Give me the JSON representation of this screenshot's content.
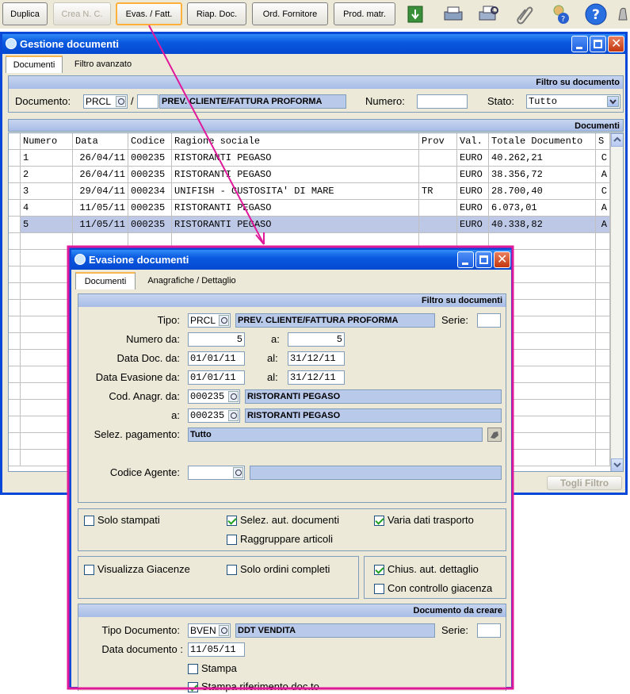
{
  "toolbar": {
    "buttons": [
      "Duplica",
      "Crea N. C.",
      "Evas. / Fatt.",
      "Riap. Doc.",
      "Ord. Fornitore",
      "Prod. matr."
    ],
    "icons": [
      "export-icon",
      "print-icon",
      "print-preview-icon",
      "attach-icon",
      "user-help-icon",
      "help-icon",
      "bell-icon"
    ]
  },
  "main": {
    "title": "Gestione documenti",
    "tabs": [
      "Documenti",
      "Filtro avanzato"
    ],
    "filter_band": "Filtro su documento",
    "documento_label": "Documento:",
    "documento_code": "PRCL",
    "documento_sep": "/",
    "documento_desc": "PREV. CLIENTE/FATTURA PROFORMA",
    "numero_label": "Numero:",
    "numero_value": "",
    "stato_label": "Stato:",
    "stato_value": "Tutto",
    "grid_band": "Documenti",
    "columns": [
      "Numero",
      "Data",
      "Codice",
      "Ragione sociale",
      "Prov",
      "Val.",
      "Totale Documento",
      "S"
    ],
    "rows": [
      [
        "1",
        "26/04/11",
        "000235",
        "RISTORANTI PEGASO",
        "",
        "EURO",
        "40.262,21",
        "C"
      ],
      [
        "2",
        "26/04/11",
        "000235",
        "RISTORANTI PEGASO",
        "",
        "EURO",
        "38.356,72",
        "A"
      ],
      [
        "3",
        "29/04/11",
        "000234",
        "UNIFISH - GUSTOSITA' DI MARE",
        "TR",
        "EURO",
        "28.700,40",
        "C"
      ],
      [
        "4",
        "11/05/11",
        "000235",
        "RISTORANTI PEGASO",
        "",
        "EURO",
        "6.073,01",
        "A"
      ],
      [
        "5",
        "11/05/11",
        "000235",
        "RISTORANTI PEGASO",
        "",
        "EURO",
        "40.338,82",
        "A"
      ]
    ],
    "selected_row": 5,
    "toggle_filter": "Togli Filtro"
  },
  "dialog": {
    "title": "Evasione documenti",
    "tabs": [
      "Documenti",
      "Anagrafiche / Dettaglio"
    ],
    "filter_band": "Filtro su documenti",
    "tipo_label": "Tipo:",
    "tipo_code": "PRCL",
    "tipo_desc": "PREV. CLIENTE/FATTURA PROFORMA",
    "serie_label": "Serie:",
    "numero_da_label": "Numero da:",
    "numero_da": "5",
    "a_label": "a:",
    "numero_a": "5",
    "data_doc_label": "Data Doc. da:",
    "data_doc_da": "01/01/11",
    "al_label": "al:",
    "data_doc_al": "31/12/11",
    "data_ev_label": "Data Evasione da:",
    "data_ev_da": "01/01/11",
    "data_ev_al": "31/12/11",
    "cod_anagr_label": "Cod. Anagr. da:",
    "cod_anagr_da": "000235",
    "cod_anagr_da_desc": "RISTORANTI PEGASO",
    "cod_anagr_a_label": "a:",
    "cod_anagr_a": "000235",
    "cod_anagr_a_desc": "RISTORANTI PEGASO",
    "pagamento_label": "Selez. pagamento:",
    "pagamento_value": "Tutto",
    "agente_label": "Codice Agente:",
    "options1": {
      "solo_stampati": "Solo stampati",
      "selez_aut": "Selez. aut. documenti",
      "varia_trasporto": "Varia dati trasporto",
      "raggruppare": "Raggruppare articoli"
    },
    "options2": {
      "visualizza_giacenze": "Visualizza Giacenze",
      "solo_ordini": "Solo ordini completi",
      "chius_aut": "Chius. aut. dettaglio",
      "controllo_giacenza": "Con controllo giacenza"
    },
    "create_band": "Documento da creare",
    "tipo_doc_label": "Tipo Documento:",
    "tipo_doc_code": "BVEN",
    "tipo_doc_desc": "DDT VENDITA",
    "serie2_label": "Serie:",
    "data_documento_label": "Data documento :",
    "data_documento": "11/05/11",
    "stampa_label": "Stampa",
    "stampa_rif_label": "Stampa riferimento doc.to"
  },
  "colors": {
    "highlight": "#e0199b",
    "selected_row": "#bcc8e6",
    "title_blue": "#0a49d8"
  }
}
